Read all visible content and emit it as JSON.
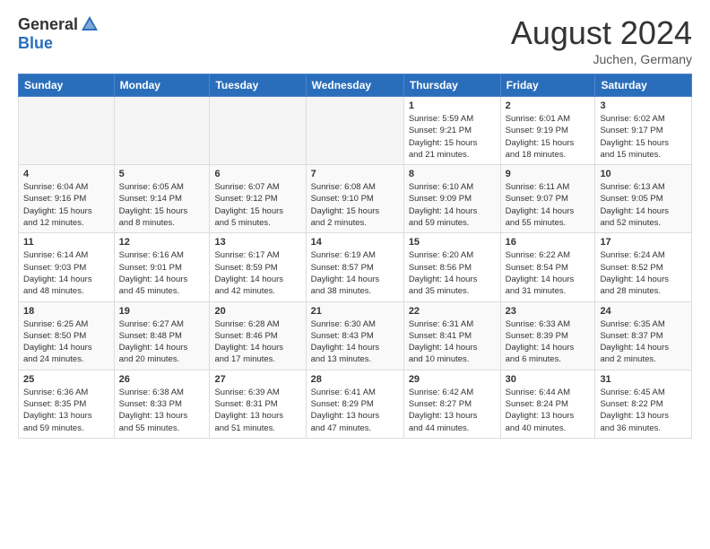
{
  "header": {
    "logo_general": "General",
    "logo_blue": "Blue",
    "title": "August 2024",
    "location": "Juchen, Germany"
  },
  "weekdays": [
    "Sunday",
    "Monday",
    "Tuesday",
    "Wednesday",
    "Thursday",
    "Friday",
    "Saturday"
  ],
  "weeks": [
    [
      {
        "day": "",
        "info": ""
      },
      {
        "day": "",
        "info": ""
      },
      {
        "day": "",
        "info": ""
      },
      {
        "day": "",
        "info": ""
      },
      {
        "day": "1",
        "info": "Sunrise: 5:59 AM\nSunset: 9:21 PM\nDaylight: 15 hours\nand 21 minutes."
      },
      {
        "day": "2",
        "info": "Sunrise: 6:01 AM\nSunset: 9:19 PM\nDaylight: 15 hours\nand 18 minutes."
      },
      {
        "day": "3",
        "info": "Sunrise: 6:02 AM\nSunset: 9:17 PM\nDaylight: 15 hours\nand 15 minutes."
      }
    ],
    [
      {
        "day": "4",
        "info": "Sunrise: 6:04 AM\nSunset: 9:16 PM\nDaylight: 15 hours\nand 12 minutes."
      },
      {
        "day": "5",
        "info": "Sunrise: 6:05 AM\nSunset: 9:14 PM\nDaylight: 15 hours\nand 8 minutes."
      },
      {
        "day": "6",
        "info": "Sunrise: 6:07 AM\nSunset: 9:12 PM\nDaylight: 15 hours\nand 5 minutes."
      },
      {
        "day": "7",
        "info": "Sunrise: 6:08 AM\nSunset: 9:10 PM\nDaylight: 15 hours\nand 2 minutes."
      },
      {
        "day": "8",
        "info": "Sunrise: 6:10 AM\nSunset: 9:09 PM\nDaylight: 14 hours\nand 59 minutes."
      },
      {
        "day": "9",
        "info": "Sunrise: 6:11 AM\nSunset: 9:07 PM\nDaylight: 14 hours\nand 55 minutes."
      },
      {
        "day": "10",
        "info": "Sunrise: 6:13 AM\nSunset: 9:05 PM\nDaylight: 14 hours\nand 52 minutes."
      }
    ],
    [
      {
        "day": "11",
        "info": "Sunrise: 6:14 AM\nSunset: 9:03 PM\nDaylight: 14 hours\nand 48 minutes."
      },
      {
        "day": "12",
        "info": "Sunrise: 6:16 AM\nSunset: 9:01 PM\nDaylight: 14 hours\nand 45 minutes."
      },
      {
        "day": "13",
        "info": "Sunrise: 6:17 AM\nSunset: 8:59 PM\nDaylight: 14 hours\nand 42 minutes."
      },
      {
        "day": "14",
        "info": "Sunrise: 6:19 AM\nSunset: 8:57 PM\nDaylight: 14 hours\nand 38 minutes."
      },
      {
        "day": "15",
        "info": "Sunrise: 6:20 AM\nSunset: 8:56 PM\nDaylight: 14 hours\nand 35 minutes."
      },
      {
        "day": "16",
        "info": "Sunrise: 6:22 AM\nSunset: 8:54 PM\nDaylight: 14 hours\nand 31 minutes."
      },
      {
        "day": "17",
        "info": "Sunrise: 6:24 AM\nSunset: 8:52 PM\nDaylight: 14 hours\nand 28 minutes."
      }
    ],
    [
      {
        "day": "18",
        "info": "Sunrise: 6:25 AM\nSunset: 8:50 PM\nDaylight: 14 hours\nand 24 minutes."
      },
      {
        "day": "19",
        "info": "Sunrise: 6:27 AM\nSunset: 8:48 PM\nDaylight: 14 hours\nand 20 minutes."
      },
      {
        "day": "20",
        "info": "Sunrise: 6:28 AM\nSunset: 8:46 PM\nDaylight: 14 hours\nand 17 minutes."
      },
      {
        "day": "21",
        "info": "Sunrise: 6:30 AM\nSunset: 8:43 PM\nDaylight: 14 hours\nand 13 minutes."
      },
      {
        "day": "22",
        "info": "Sunrise: 6:31 AM\nSunset: 8:41 PM\nDaylight: 14 hours\nand 10 minutes."
      },
      {
        "day": "23",
        "info": "Sunrise: 6:33 AM\nSunset: 8:39 PM\nDaylight: 14 hours\nand 6 minutes."
      },
      {
        "day": "24",
        "info": "Sunrise: 6:35 AM\nSunset: 8:37 PM\nDaylight: 14 hours\nand 2 minutes."
      }
    ],
    [
      {
        "day": "25",
        "info": "Sunrise: 6:36 AM\nSunset: 8:35 PM\nDaylight: 13 hours\nand 59 minutes."
      },
      {
        "day": "26",
        "info": "Sunrise: 6:38 AM\nSunset: 8:33 PM\nDaylight: 13 hours\nand 55 minutes."
      },
      {
        "day": "27",
        "info": "Sunrise: 6:39 AM\nSunset: 8:31 PM\nDaylight: 13 hours\nand 51 minutes."
      },
      {
        "day": "28",
        "info": "Sunrise: 6:41 AM\nSunset: 8:29 PM\nDaylight: 13 hours\nand 47 minutes."
      },
      {
        "day": "29",
        "info": "Sunrise: 6:42 AM\nSunset: 8:27 PM\nDaylight: 13 hours\nand 44 minutes."
      },
      {
        "day": "30",
        "info": "Sunrise: 6:44 AM\nSunset: 8:24 PM\nDaylight: 13 hours\nand 40 minutes."
      },
      {
        "day": "31",
        "info": "Sunrise: 6:45 AM\nSunset: 8:22 PM\nDaylight: 13 hours\nand 36 minutes."
      }
    ]
  ]
}
